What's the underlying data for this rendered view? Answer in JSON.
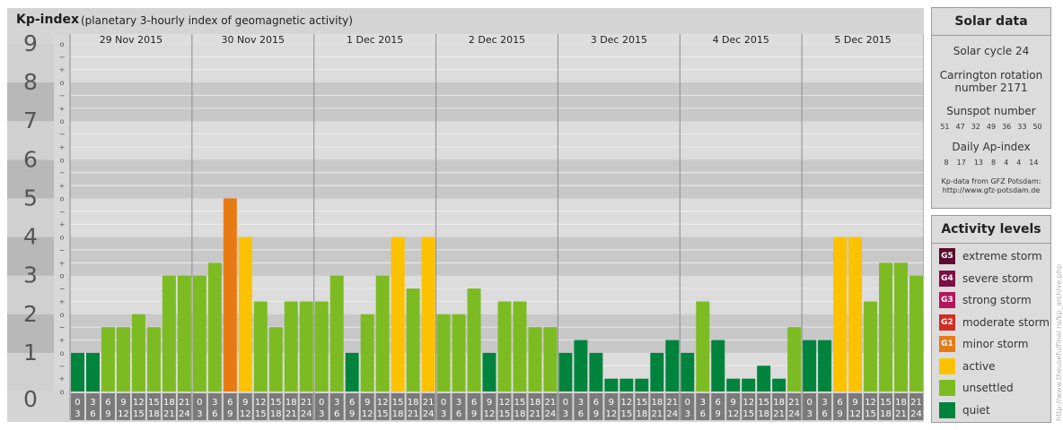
{
  "header": {
    "title": "Kp-index",
    "subtitle": "(planetary 3-hourly index of geomagnetic activity)"
  },
  "chart_data": {
    "type": "bar",
    "title": "Kp-index",
    "subtitle": "(planetary 3-hourly index of geomagnetic activity)",
    "xlabel": "",
    "ylabel": "",
    "ylim": [
      0,
      9
    ],
    "y_ticks": [
      "0",
      "1",
      "2",
      "3",
      "4",
      "5",
      "6",
      "7",
      "8",
      "9"
    ],
    "minor_tick_labels": [
      "−",
      "o",
      "+"
    ],
    "days": [
      "29 Nov 2015",
      "30 Nov 2015",
      "1 Dec 2015",
      "2 Dec 2015",
      "3 Dec 2015",
      "4 Dec 2015",
      "5 Dec 2015"
    ],
    "intervals": [
      {
        "start": "0",
        "end": "3"
      },
      {
        "start": "3",
        "end": "6"
      },
      {
        "start": "6",
        "end": "9"
      },
      {
        "start": "9",
        "end": "12"
      },
      {
        "start": "12",
        "end": "15"
      },
      {
        "start": "15",
        "end": "18"
      },
      {
        "start": "18",
        "end": "21"
      },
      {
        "start": "21",
        "end": "24"
      }
    ],
    "values": [
      [
        1,
        1,
        1.667,
        1.667,
        2,
        1.667,
        3,
        3
      ],
      [
        3,
        3.333,
        5,
        4,
        2.333,
        1.667,
        2.333,
        2.333
      ],
      [
        2.333,
        3,
        1,
        2,
        3,
        4,
        2.667,
        4
      ],
      [
        2,
        2,
        2.667,
        1,
        2.333,
        2.333,
        1.667,
        1.667
      ],
      [
        1,
        1.333,
        1,
        0.333,
        0.333,
        0.333,
        1,
        1.333
      ],
      [
        1,
        2.333,
        1.333,
        0.333,
        0.333,
        0.667,
        0.333,
        1.667
      ],
      [
        1.333,
        1.333,
        4,
        4,
        2.333,
        3.333,
        3.333,
        3
      ]
    ],
    "legend_placement": "right",
    "grid": true,
    "colors": {
      "quiet": "#00843d",
      "unsettled": "#7dbb23",
      "active": "#fcc200",
      "minor_storm": "#e87a14",
      "panel_bg": "#d4d4d4",
      "band_dark": "#c8c8c8",
      "band_light": "#dcdcdc"
    }
  },
  "solar": {
    "title": "Solar data",
    "cycle": "Solar cycle 24",
    "carrington_1": "Carrington rotation",
    "carrington_2": "number 2171",
    "sunspot_title": "Sunspot number",
    "sunspots": [
      "51",
      "47",
      "32",
      "49",
      "36",
      "33",
      "50"
    ],
    "ap_title": "Daily Ap-index",
    "ap": [
      "8",
      "17",
      "13",
      "8",
      "4",
      "4",
      "14"
    ],
    "source_1": "Kp-data from GFZ Potsdam:",
    "source_2": "http://www.gfz-potsdam.de"
  },
  "activity": {
    "title": "Activity levels",
    "levels": [
      {
        "badge": "G5",
        "label": "extreme storm",
        "color": "#5c0a2e"
      },
      {
        "badge": "G4",
        "label": "severe storm",
        "color": "#7d0f44"
      },
      {
        "badge": "G3",
        "label": "strong storm",
        "color": "#b5155b"
      },
      {
        "badge": "G2",
        "label": "moderate storm",
        "color": "#d42c20"
      },
      {
        "badge": "G1",
        "label": "minor storm",
        "color": "#e87a14"
      },
      {
        "badge": "",
        "label": "active",
        "color": "#fcc200"
      },
      {
        "badge": "",
        "label": "unsettled",
        "color": "#7dbb23"
      },
      {
        "badge": "",
        "label": "quiet",
        "color": "#00843d"
      }
    ]
  },
  "credit": "http://www.theusefulfinal.ru/kp_archive.php"
}
